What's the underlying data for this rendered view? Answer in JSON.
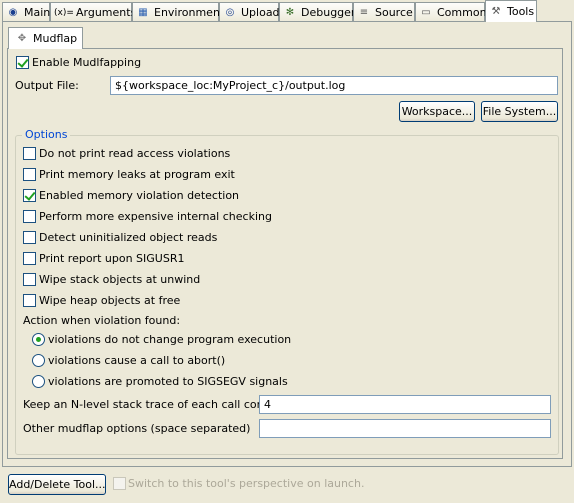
{
  "tabs": [
    {
      "label": "Main",
      "icon": "main-icon"
    },
    {
      "label": "Arguments",
      "icon": "arguments-icon"
    },
    {
      "label": "Environment",
      "icon": "environment-icon"
    },
    {
      "label": "Upload",
      "icon": "upload-icon"
    },
    {
      "label": "Debugger",
      "icon": "debugger-icon"
    },
    {
      "label": "Source",
      "icon": "source-icon"
    },
    {
      "label": "Common",
      "icon": "common-icon"
    },
    {
      "label": "Tools",
      "icon": "tools-icon",
      "active": true
    }
  ],
  "tabs_icon_glyphs": [
    "◉",
    "(x)=",
    "▦",
    "◎",
    "✻",
    "≡",
    "▭",
    "⚒"
  ],
  "subtab": {
    "label": "Mudflap",
    "icon": "mudflap-icon"
  },
  "enable": {
    "label": "Enable Mudlfapping",
    "checked": true
  },
  "output_file": {
    "label": "Output File:",
    "value": "${workspace_loc:MyProject_c}/output.log"
  },
  "buttons": {
    "workspace": "Workspace...",
    "file_system": "File System..."
  },
  "options": {
    "title": "Options",
    "checks": [
      {
        "label": "Do not print read access violations",
        "checked": false
      },
      {
        "label": "Print memory leaks at program exit",
        "checked": false
      },
      {
        "label": "Enabled memory violation detection",
        "checked": true
      },
      {
        "label": "Perform more expensive internal checking",
        "checked": false
      },
      {
        "label": "Detect uninitialized object reads",
        "checked": false
      },
      {
        "label": "Print report upon SIGUSR1",
        "checked": false
      },
      {
        "label": "Wipe stack objects at unwind",
        "checked": false
      },
      {
        "label": "Wipe heap objects at free",
        "checked": false
      }
    ],
    "action_label": "Action when violation found:",
    "radios": [
      {
        "label": "violations do not change program execution",
        "checked": true
      },
      {
        "label": "violations cause a call to abort()",
        "checked": false
      },
      {
        "label": "violations are promoted to SIGSEGV signals",
        "checked": false
      }
    ],
    "stack_trace": {
      "label": "Keep an N-level stack trace of each call context",
      "value": "4"
    },
    "other_options": {
      "label": "Other mudflap options (space separated)",
      "value": ""
    }
  },
  "footer": {
    "add_delete": "Add/Delete Tool...",
    "switch_label": "Switch to this tool's perspective on launch.",
    "switch_checked": false
  }
}
